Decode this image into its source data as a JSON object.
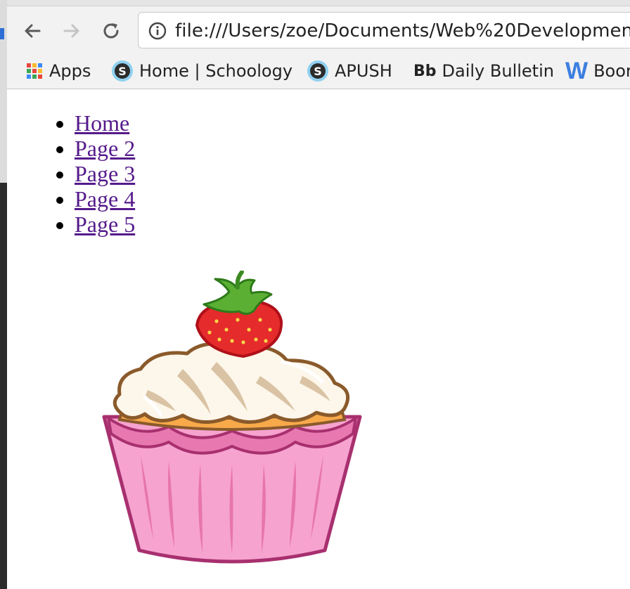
{
  "browser": {
    "url": "file:///Users/zoe/Documents/Web%20Developmen"
  },
  "bookmarks": [
    {
      "label": "Apps",
      "icon": "apps-grid-icon"
    },
    {
      "label": "Home | Schoology",
      "icon": "schoology-icon"
    },
    {
      "label": "APUSH",
      "icon": "schoology-icon"
    },
    {
      "label": "Daily Bulletin",
      "icon": "bb-icon",
      "icon_text": "Bb"
    },
    {
      "label": "Boor",
      "icon": "w-icon",
      "icon_text": "W"
    }
  ],
  "nav_links": [
    "Home",
    "Page 2",
    "Page 3",
    "Page 4",
    "Page 5"
  ],
  "image": {
    "name": "cupcake-image"
  },
  "colors": {
    "link": "#551a8b",
    "frosting_outline": "#8a5a2b",
    "wrapper": "#f39ac8",
    "strawberry": "#e52b2b"
  }
}
